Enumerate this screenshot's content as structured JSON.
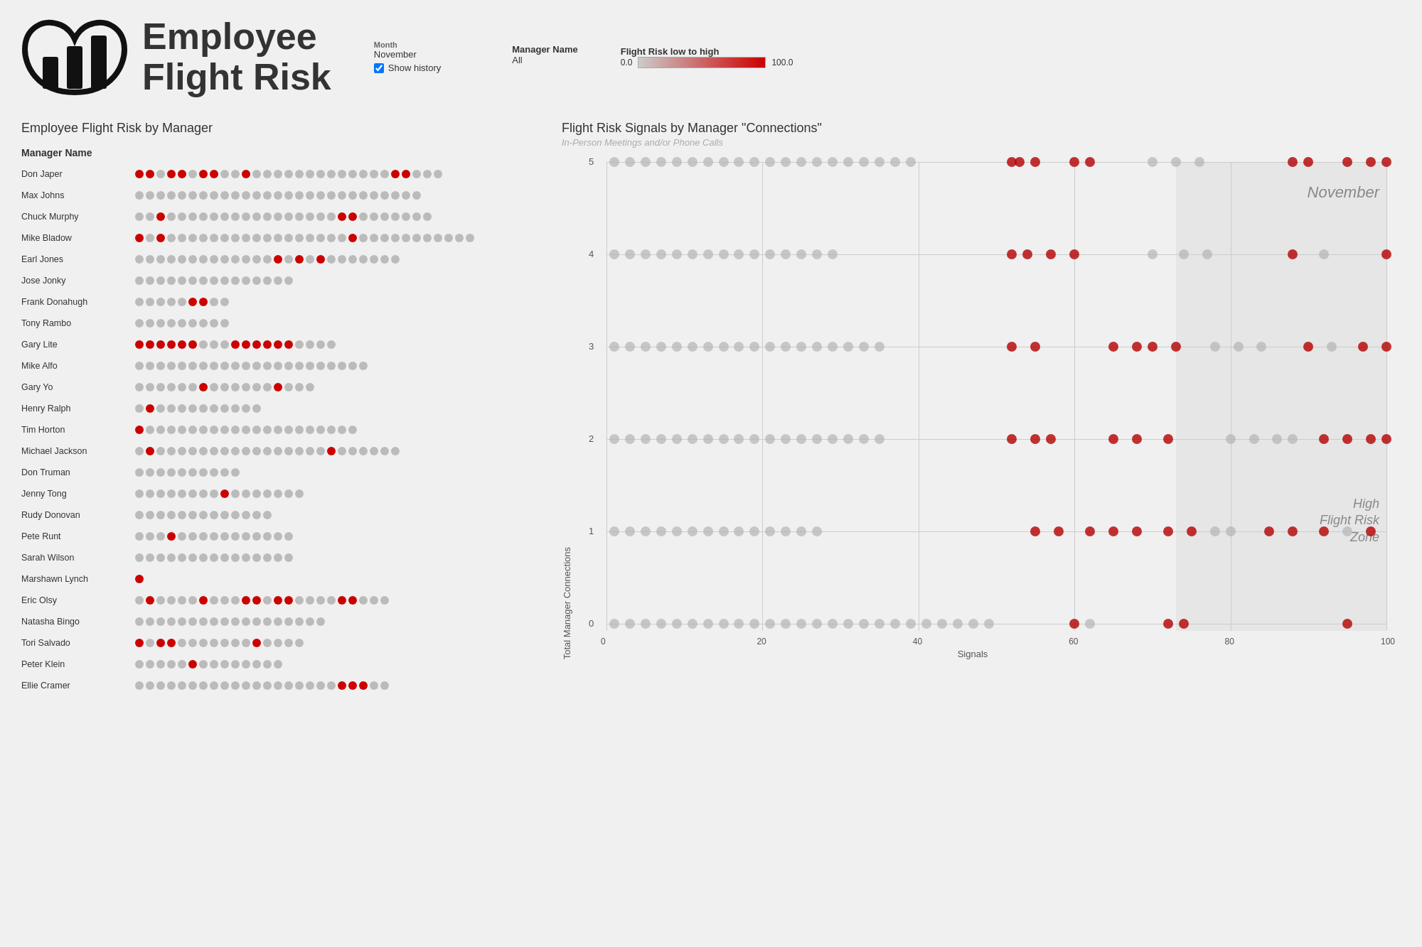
{
  "header": {
    "title_line1": "Employee",
    "title_line2": "Flight Risk",
    "filter_month_label": "Month",
    "filter_month_value": "November",
    "filter_show_history": "Show history",
    "filter_manager_label": "Manager Name",
    "filter_manager_value": "All",
    "legend_title": "Flight Risk low to high",
    "legend_min": "0.0",
    "legend_max": "100.0"
  },
  "left_section": {
    "title": "Employee Flight Risk by Manager",
    "col_header": "Manager Name",
    "managers": [
      {
        "name": "Don Japer",
        "dots": "RRGRRGRRGGRG GGGGGGGGGGGG RRGGG"
      },
      {
        "name": "Max Johns",
        "dots": "GGGGGGGGGGGG GGGGGGGGGGGG GGG"
      },
      {
        "name": "Chuck Murphy",
        "dots": "GGRGGGGGGGGGG GGGGGGRRGGG GGGG"
      },
      {
        "name": "Mike Bladow",
        "dots": "RGRGGGGGGGGGG GGGGGGGRGGG GGGGG GGG"
      },
      {
        "name": "Earl Jones",
        "dots": "GGGGGGGGGGGGG RGRGRGGGGGG G"
      },
      {
        "name": "Jose Jonky",
        "dots": "GGGGGGGGGGGG GGG"
      },
      {
        "name": "Frank Donahugh",
        "dots": "GGGGGRR GG"
      },
      {
        "name": "Tony Rambo",
        "dots": "GGGGGGGGG"
      },
      {
        "name": "Gary Lite",
        "dots": "RRRRRRGGG RRRRRRGGG G"
      },
      {
        "name": "Mike Alfo",
        "dots": "GGGGGGGGGGGG GGGGGGGGGG"
      },
      {
        "name": "Gary Yo",
        "dots": "GGGGGGRGGGG GGRGGG"
      },
      {
        "name": "Henry Ralph",
        "dots": "GRGGGGGGG GGG"
      },
      {
        "name": "Tim Horton",
        "dots": "RGGGGGGGGGGGG GGGGGGGG"
      },
      {
        "name": "Michael Jackson",
        "dots": "GRGGGGGGGGGGG GGGGGRGGG GGG"
      },
      {
        "name": "Don Truman",
        "dots": "GGGGGGGGGG"
      },
      {
        "name": "Jenny Tong",
        "dots": "GGGGGGGGRGGG GGGG"
      },
      {
        "name": "Rudy Donovan",
        "dots": "GGGGGGGGGG GGG"
      },
      {
        "name": "Pete Runt",
        "dots": "GGGRGGGGGGG GGGG"
      },
      {
        "name": "Sarah Wilson",
        "dots": "GGGGGGGGGGGG GGG"
      },
      {
        "name": "Marshawn Lynch",
        "dots": "R"
      },
      {
        "name": "Eric Olsy",
        "dots": "GRGGGGRGGG RRGRRGGGG RRGGG"
      },
      {
        "name": "Natasha Bingo",
        "dots": "GGGGGGGGGGGG GGGGGG"
      },
      {
        "name": "Tori Salvado",
        "dots": "RGRRGGGGGGG RGGGG"
      },
      {
        "name": "Peter Klein",
        "dots": "GGGGGRGGGGG GGG"
      },
      {
        "name": "Ellie Cramer",
        "dots": "GGGGGGGGGGG GGGGGGGGRRRG G"
      }
    ]
  },
  "right_section": {
    "title": "Flight Risk Signals by Manager \"Connections\"",
    "subtitle": "In-Person Meetings and/or Phone Calls",
    "y_axis_label": "Total Manager Connections",
    "x_axis_label": "Signals",
    "november_label": "November",
    "high_flight_label": "High\nFlight Risk\nZone",
    "x_ticks": [
      "0",
      "20",
      "40",
      "60",
      "80",
      "100"
    ],
    "y_ticks": [
      "0",
      "1",
      "2",
      "3",
      "4",
      "5"
    ]
  }
}
